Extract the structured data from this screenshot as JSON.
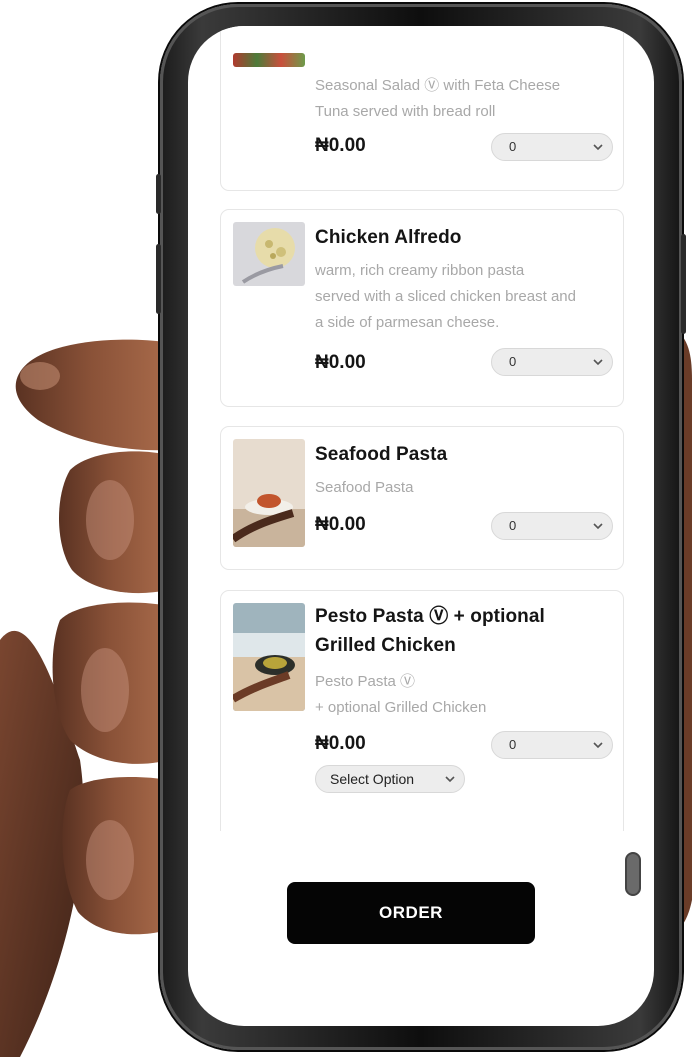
{
  "menu_items": [
    {
      "name": "",
      "description_lines": [
        "Seasonal Salad Ⓥ with Feta Cheese",
        "Tuna served with bread roll"
      ],
      "price": "₦0.00",
      "quantity": "0"
    },
    {
      "name": "Chicken Alfredo",
      "description_lines": [
        "warm, rich  creamy ribbon pasta",
        "served with a sliced chicken breast and",
        "a side of parmesan cheese."
      ],
      "price": "₦0.00",
      "quantity": "0"
    },
    {
      "name": "Seafood Pasta",
      "description_lines": [
        "Seafood Pasta"
      ],
      "price": "₦0.00",
      "quantity": "0"
    },
    {
      "name_lines": [
        "Pesto Pasta Ⓥ + optional",
        "Grilled Chicken"
      ],
      "description_lines": [
        "Pesto Pasta Ⓥ",
        "+ optional Grilled Chicken"
      ],
      "price": "₦0.00",
      "quantity": "0",
      "option_label": "Select Option"
    }
  ],
  "order_button_label": "ORDER",
  "colors": {
    "button": "#050505",
    "desc_text": "#a8a8a8",
    "field_bg": "#ededed"
  },
  "icons": [
    "chevron-down-icon",
    "scroll-handle-icon"
  ]
}
